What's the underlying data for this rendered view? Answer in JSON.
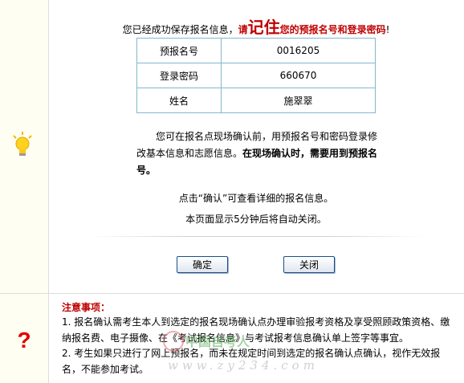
{
  "headline": {
    "prefix": "您已经成功保存报名信息，",
    "please": "请",
    "remember": "记住",
    "suffix": "您的预报名号和登录密码",
    "end": "!"
  },
  "info_table": [
    {
      "label": "预报名号",
      "value": "0016205"
    },
    {
      "label": "登录密码",
      "value": "660670"
    },
    {
      "label": "姓名",
      "value": "施翠翠"
    }
  ],
  "message": {
    "text": "您可在报名点现场确认前，用预报名号和密码登录修改基本信息和志愿信息。",
    "bold": "在现场确认时，需要用到预报名号。"
  },
  "hint": "点击“确认”可查看详细的报名信息。",
  "auto_close": "本页面显示5分钟后将自动关闭。",
  "buttons": {
    "ok": "确定",
    "close": "关闭"
  },
  "notes": {
    "title": "注意事项：",
    "items": [
      "1. 报名确认需考生本人到选定的报名现场确认点办理审验报考资格及享受照顾政策资格、缴纳报名费、电子摄像、在《考试报名信息》与考试报考信息确认单上签字等事宜。",
      "2. 考生如果只进行了网上预报名，而未在规定时间到选定的报名确认点确认，视作无效报名，不能参加考试。"
    ]
  },
  "watermark": {
    "name": "中国自考人",
    "url": "www.zy234.com"
  },
  "colors": {
    "accent_red": "#c00000",
    "table_border": "#82b7cf",
    "button_border": "#1b4f8a"
  },
  "icons": {
    "tip": "lightbulb-icon",
    "notice": "question-mark-icon"
  }
}
